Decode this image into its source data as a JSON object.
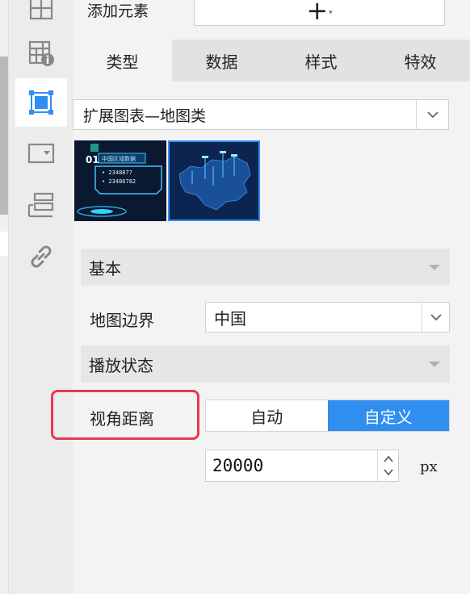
{
  "left_toolbar": {
    "icons": [
      "grid-icon",
      "table-info-icon",
      "frame-select-icon",
      "dropdown-box-icon",
      "layout-list-icon",
      "link-icon"
    ],
    "active": "frame-select-icon",
    "accent": "#2f8ef0"
  },
  "add_element": {
    "label": "添加元素",
    "button_symbol": "+",
    "button_caret": "▾"
  },
  "tabs": [
    {
      "label": "类型",
      "active": true
    },
    {
      "label": "数据",
      "active": false
    },
    {
      "label": "样式",
      "active": false
    },
    {
      "label": "特效",
      "active": false
    }
  ],
  "chart_type_select": {
    "value": "扩展图表—地图类"
  },
  "thumbnails": {
    "first": {
      "number": "01",
      "title": "中国区域数据",
      "line1": "• 2348877",
      "line2": "• 23486782"
    }
  },
  "sections": {
    "basic": "基本",
    "playback": "播放状态"
  },
  "map_boundary": {
    "label": "地图边界",
    "value": "中国"
  },
  "view_distance": {
    "label": "视角距离",
    "options": [
      "自动",
      "自定义"
    ],
    "selected": "自定义",
    "value": "20000",
    "unit": "px"
  },
  "colors": {
    "accent": "#2f8ef0",
    "highlight": "#e8394f"
  }
}
